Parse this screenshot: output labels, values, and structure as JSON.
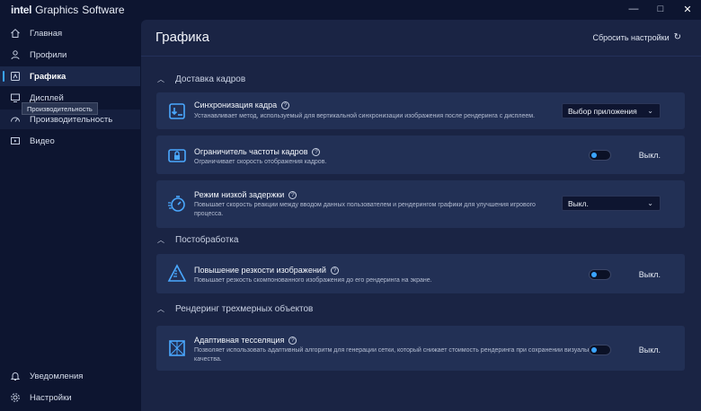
{
  "window": {
    "brand_intel": "intel",
    "brand_graphics": "Graphics",
    "brand_software": "Software",
    "minimize": "—",
    "maximize": "□",
    "close": "✕"
  },
  "sidebar": {
    "items": [
      {
        "label": "Главная",
        "icon": "home-icon"
      },
      {
        "label": "Профили",
        "icon": "profile-icon"
      },
      {
        "label": "Графика",
        "icon": "graphics-icon"
      },
      {
        "label": "Дисплей",
        "icon": "display-icon"
      },
      {
        "label": "Производительность",
        "icon": "performance-icon"
      },
      {
        "label": "Видео",
        "icon": "video-icon"
      }
    ],
    "tooltip": "Производительность",
    "bottom": [
      {
        "label": "Уведомления",
        "icon": "bell-icon"
      },
      {
        "label": "Настройки",
        "icon": "gear-icon"
      }
    ]
  },
  "main": {
    "title": "Графика",
    "reset_label": "Сбросить настройки"
  },
  "sections": [
    {
      "title": "Доставка кадров",
      "cards": [
        {
          "title": "Синхронизация кадра",
          "desc": "Устанавливает метод, используемый для вертикальной синхронизации изображения после рендеринга с дисплеем.",
          "control": "dropdown",
          "value": "Выбор приложения"
        },
        {
          "title": "Ограничитель частоты кадров",
          "desc": "Ограничивает скорость отображения кадров.",
          "control": "toggle",
          "value": "Выкл."
        },
        {
          "title": "Режим низкой задержки",
          "desc_line1": "Повышает скорость реакции между вводом данных пользователем и рендерингом графики для улучшения игрового",
          "desc_line2": "процесса.",
          "control": "dropdown",
          "value": "Выкл."
        }
      ]
    },
    {
      "title": "Постобработка",
      "cards": [
        {
          "title": "Повышение резкости изображений",
          "desc": "Повышает резкость скомпонованного изображения до его рендеринга на экране.",
          "control": "toggle",
          "value": "Выкл."
        }
      ]
    },
    {
      "title": "Рендеринг трехмерных объектов",
      "cards": [
        {
          "title": "Адаптивная тесселяция",
          "desc_line1": "Позволяет использовать адаптивный алгоритм для генерации сетки, который снижает стоимость рендеринга при сохранении визуального",
          "desc_line2": "качества.",
          "control": "toggle",
          "value": "Выкл."
        }
      ]
    }
  ],
  "colors": {
    "accent": "#3aa4ff",
    "background": "#0d1530",
    "panel": "#1a2444",
    "card": "#223055"
  }
}
